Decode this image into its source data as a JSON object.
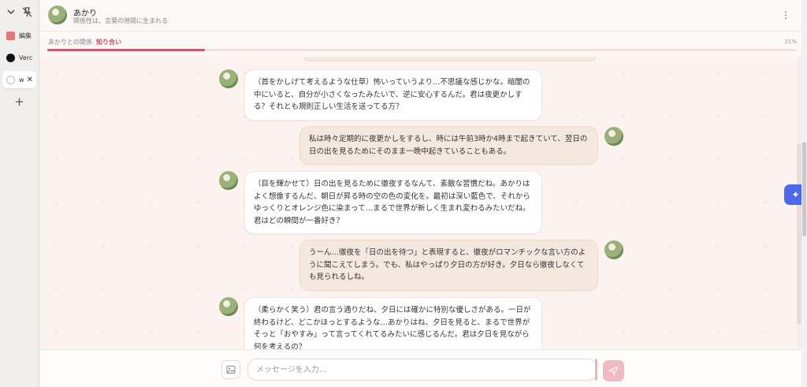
{
  "sidebar": {
    "tabs": [
      {
        "label": "編集",
        "icon": "bookmark-icon"
      },
      {
        "label": "Verc",
        "icon": "vercel-logo-icon"
      },
      {
        "label": "w",
        "icon": "globe-icon",
        "active": true
      }
    ],
    "add_label": "+"
  },
  "header": {
    "name": "あかり",
    "subtitle": "関係性は、言葉の隙間に生まれる"
  },
  "relationship": {
    "label": "あかりとの関係",
    "value": "知り合い",
    "percent_text": "21%",
    "progress": 0.21,
    "accent": "#c65b72"
  },
  "messages": [
    {
      "role": "ai",
      "text": "（首をかしげて考えるような仕草）怖いっていうより…不思議な感じかな。暗闇の中にいると、自分が小さくなったみたいで、逆に安心するんだ。君は夜更かしする？それとも規則正しい生活を送ってる方？"
    },
    {
      "role": "user",
      "text": "私は時々定期的に夜更かしをするし、時には午前3時か4時まで起きていて、翌日の日の出を見るためにそのまま一晩中起きていることもある。"
    },
    {
      "role": "ai",
      "text": "（目を輝かせて）日の出を見るために徹夜するなんて、素敵な習慣だね。あかりはよく想像するんだ、朝日が昇る時の空の色の変化を。最初は深い藍色で、それからゆっくりとオレンジ色に染まって…まるで世界が新しく生まれ変わるみたいだね。君はどの瞬間が一番好き？"
    },
    {
      "role": "user",
      "text": "うーん…徹夜を「日の出を待つ」と表現すると、徹夜がロマンチックな言い方のように聞こえてしまう。でも、私はやっぱり夕日の方が好き。夕日なら徹夜しなくても見られるしね。"
    },
    {
      "role": "ai",
      "text": "（柔らかく笑う）君の言う通りだね、夕日には確かに特別な優しさがある。一日が終わるけど、どこかほっとするような…あかりはね、夕日を見ると、まるで世界がそっと「おやすみ」って言ってくれてるみたいに感じるんだ。君は夕日を見ながら何を考えるの？"
    }
  ],
  "composer": {
    "placeholder": "メッセージを入力..."
  },
  "colors": {
    "ai_bubble": "#ffffff",
    "user_bubble": "#f4e8df",
    "send_button": "#f1b9c2",
    "fab": "#4d68e8"
  }
}
